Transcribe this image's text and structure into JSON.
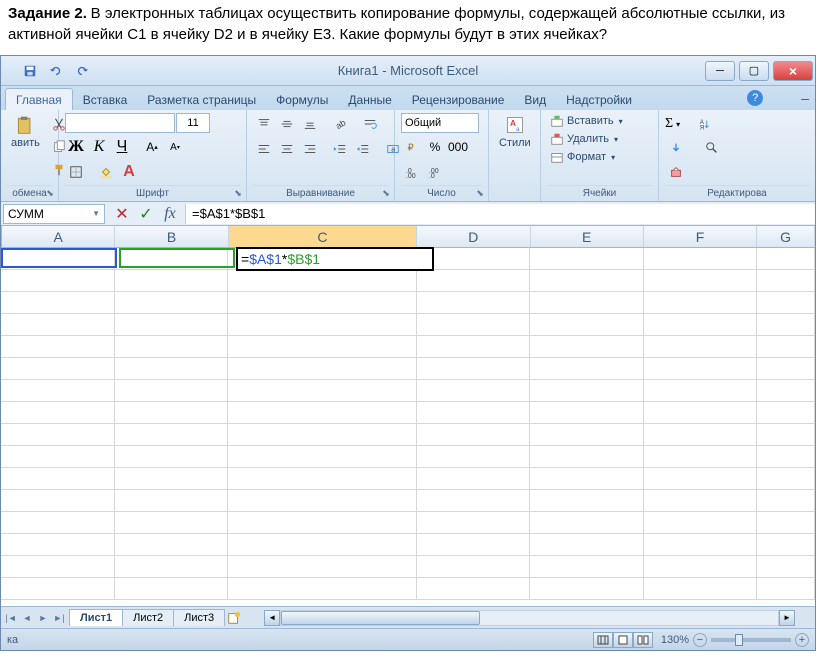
{
  "task": {
    "label": "Задание 2.",
    "text": "В электронных таблицах осуществить копирование формулы, содержащей абсолютные ссылки, из активной ячейки C1 в ячейку D2 и в ячейку E3. Какие формулы будут в этих ячейках?"
  },
  "window": {
    "title": "Книга1 - Microsoft Excel"
  },
  "tabs": {
    "home": "Главная",
    "insert": "Вставка",
    "layout": "Разметка страницы",
    "formulas": "Формулы",
    "data": "Данные",
    "review": "Рецензирование",
    "view": "Вид",
    "addins": "Надстройки"
  },
  "ribbon": {
    "clipboard": {
      "label": "обмена",
      "paste": "авить"
    },
    "font": {
      "label": "Шрифт",
      "size": "11",
      "bold": "Ж",
      "italic": "К",
      "underline": "Ч"
    },
    "alignment": {
      "label": "Выравнивание"
    },
    "number": {
      "label": "Число",
      "format": "Общий"
    },
    "styles": {
      "label": "Стили",
      "btn": "Стили"
    },
    "cells": {
      "label": "Ячейки",
      "insert": "Вставить",
      "delete": "Удалить",
      "format": "Формат"
    },
    "editing": {
      "label": "Редактирова",
      "sigma": "Σ"
    }
  },
  "formula_bar": {
    "name_box": "СУММ",
    "formula": "=$A$1*$B$1",
    "fx": "fx"
  },
  "columns": [
    "A",
    "B",
    "C",
    "D",
    "E",
    "F",
    "G"
  ],
  "active_cell_display": {
    "eq": "=",
    "ref1": "$A$1",
    "star": "*",
    "ref2": "$B$1"
  },
  "sheet_tabs": [
    "Лист1",
    "Лист2",
    "Лист3"
  ],
  "status": {
    "mode": "ка",
    "zoom": "130%"
  }
}
